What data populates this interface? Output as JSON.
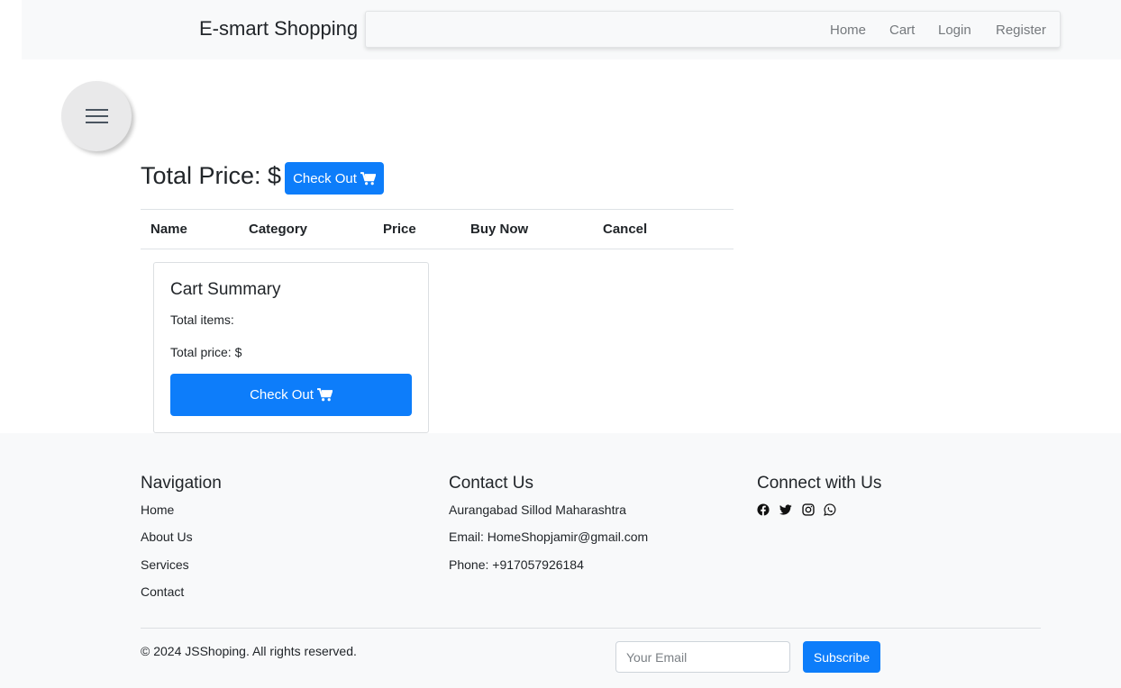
{
  "header": {
    "brand": "E-smart Shopping",
    "nav": [
      "Home",
      "Cart",
      "Login",
      "Register"
    ]
  },
  "cart": {
    "total_label": "Total Price: $",
    "checkout_label": "Check Out",
    "columns": [
      "Name",
      "Category",
      "Price",
      "Buy Now",
      "Cancel"
    ]
  },
  "summary": {
    "title": "Cart Summary",
    "total_items": "Total items:",
    "total_price": "Total price: $",
    "checkout_label": "Check Out"
  },
  "footer": {
    "navigation": {
      "heading": "Navigation",
      "links": [
        "Home",
        "About Us",
        "Services",
        "Contact"
      ]
    },
    "contact": {
      "heading": "Contact Us",
      "address": "Aurangabad Sillod Maharashtra",
      "email": "Email: HomeShopjamir@gmail.com",
      "phone": "Phone: +917057926184"
    },
    "social": {
      "heading": "Connect with Us",
      "icons": [
        "facebook-icon",
        "twitter-icon",
        "instagram-icon",
        "whatsapp-icon"
      ]
    },
    "copyright": "© 2024 JSShoping. All rights reserved.",
    "email_placeholder": "Your Email",
    "subscribe_label": "Subscribe"
  },
  "colors": {
    "primary": "#0d7dfa",
    "header_bg": "#f8f9fa",
    "footer_bg": "#f8f9fa"
  }
}
